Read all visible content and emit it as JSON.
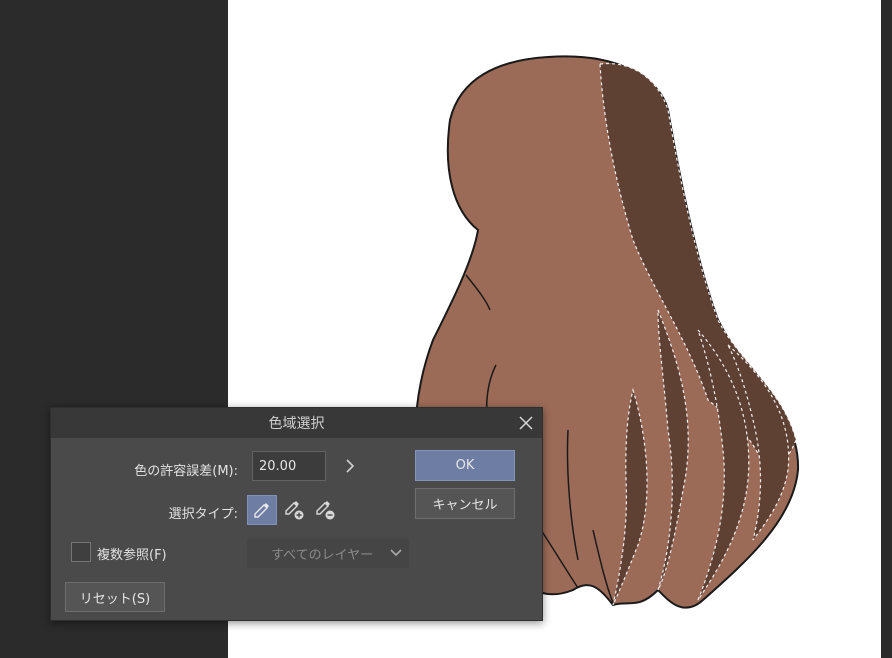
{
  "dialog": {
    "title": "色域選択",
    "tolerance_label": "色の許容誤差(M):",
    "tolerance_value": "20.00",
    "select_type_label": "選択タイプ:",
    "multi_ref_label": "複数参照(F)",
    "layer_option": "すべてのレイヤー",
    "ok_label": "OK",
    "cancel_label": "キャンセル",
    "reset_label": "リセット(S)",
    "icons": {
      "close": "close-icon",
      "expand": "chevron-right-icon",
      "select": "eyedropper-icon",
      "add": "eyedropper-add-icon",
      "remove": "eyedropper-remove-icon",
      "dropdown": "chevron-down-icon"
    }
  },
  "colors": {
    "hair_light": "#9c6b58",
    "hair_dark": "#5f4134",
    "accent": "#6e7da3"
  }
}
